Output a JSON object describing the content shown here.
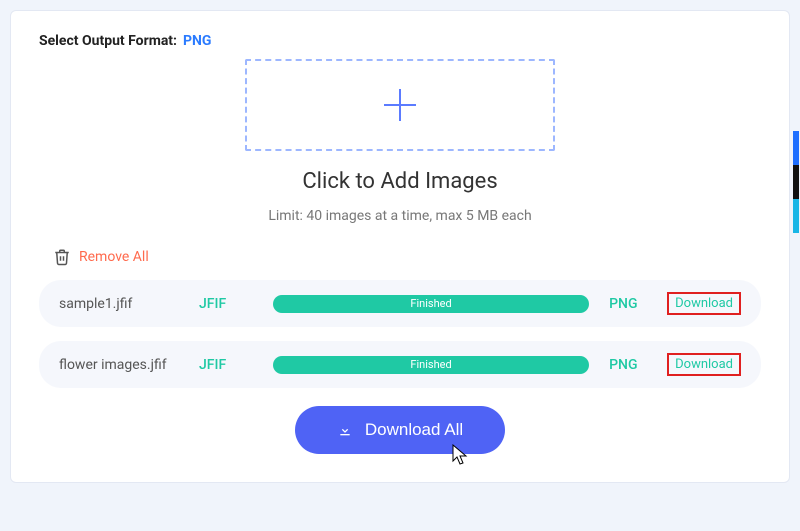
{
  "header": {
    "label": "Select Output Format:",
    "value": "PNG"
  },
  "dropzone": {
    "add_text": "Click to Add Images",
    "limit_text": "Limit: 40 images at a time, max 5 MB each"
  },
  "remove_all_label": "Remove All",
  "files": [
    {
      "name": "sample1.jfif",
      "src": "JFIF",
      "status": "Finished",
      "dst": "PNG",
      "download_label": "Download"
    },
    {
      "name": "flower images.jfif",
      "src": "JFIF",
      "status": "Finished",
      "dst": "PNG",
      "download_label": "Download"
    }
  ],
  "download_all_label": "Download All"
}
